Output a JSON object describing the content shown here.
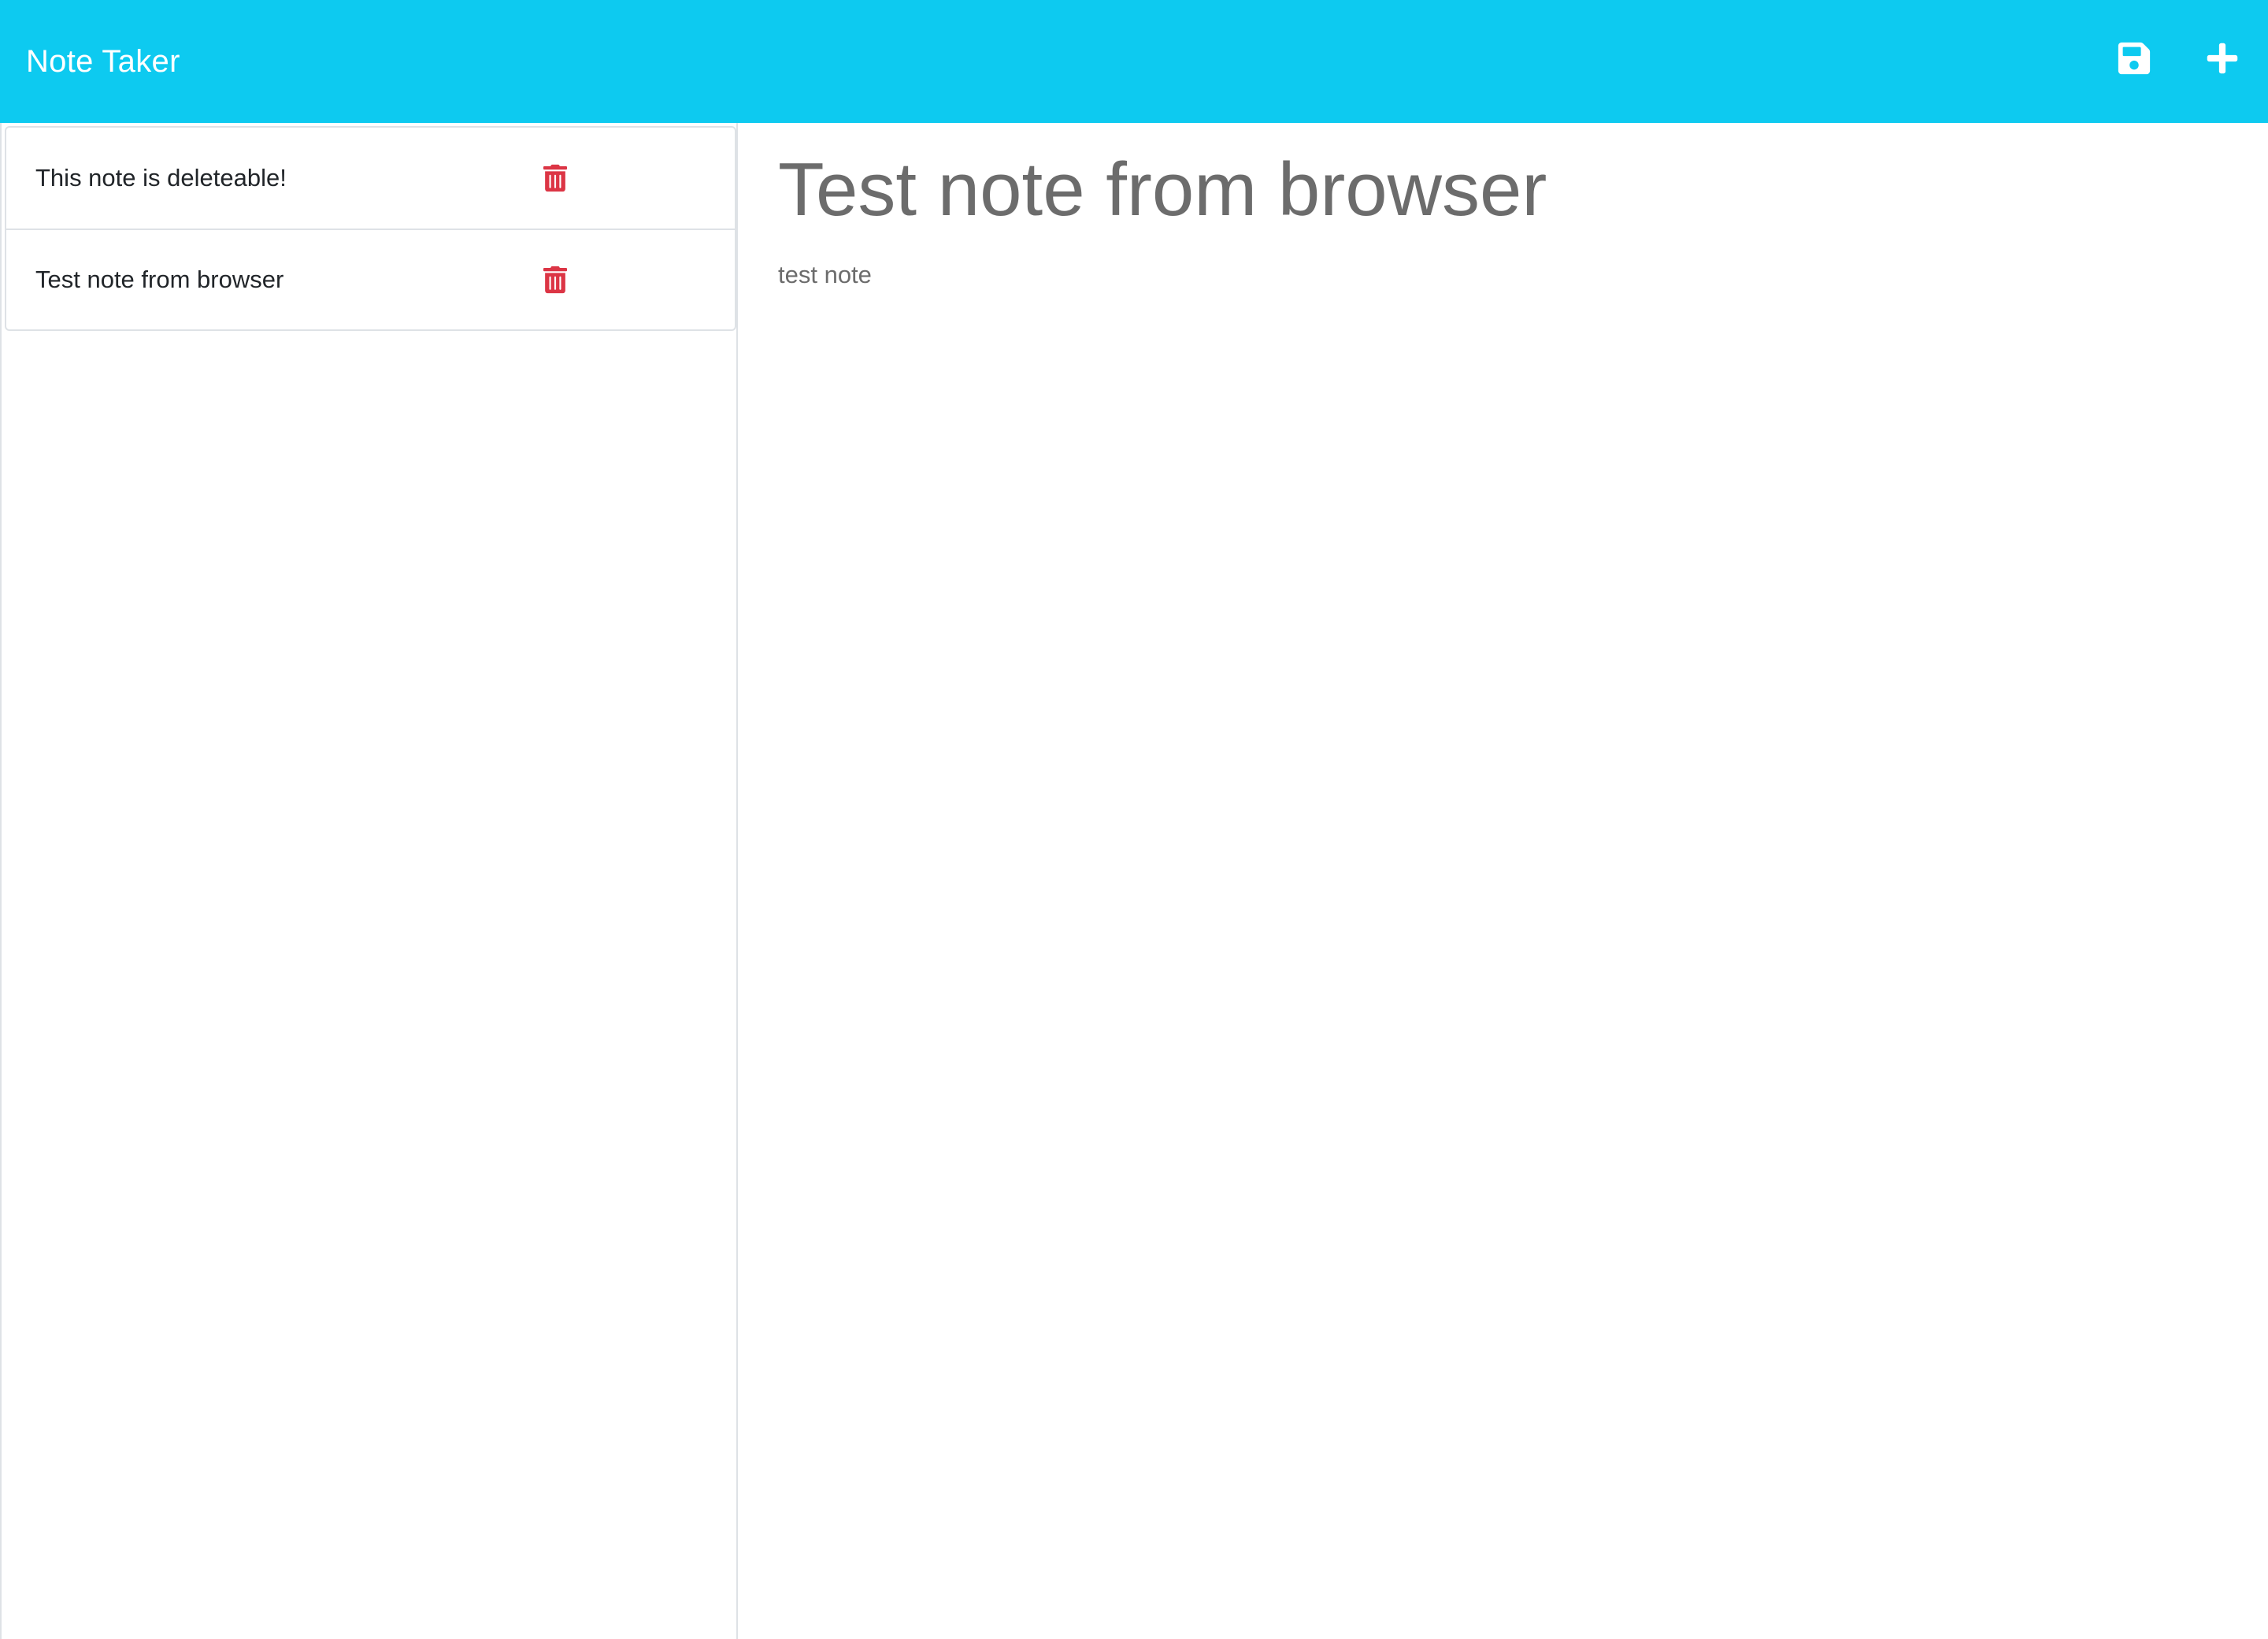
{
  "app": {
    "title": "Note Taker",
    "accent_color": "#0dcaf0"
  },
  "toolbar": {
    "save_icon": "save-icon",
    "new_icon": "plus-icon"
  },
  "sidebar": {
    "notes": [
      {
        "title": "This note is deleteable!",
        "delete_icon": "trash-icon",
        "delete_color": "#dc3545"
      },
      {
        "title": "Test note from browser",
        "delete_icon": "trash-icon",
        "delete_color": "#dc3545"
      }
    ]
  },
  "editor": {
    "title_value": "Test note from browser",
    "text_value": "test note"
  }
}
